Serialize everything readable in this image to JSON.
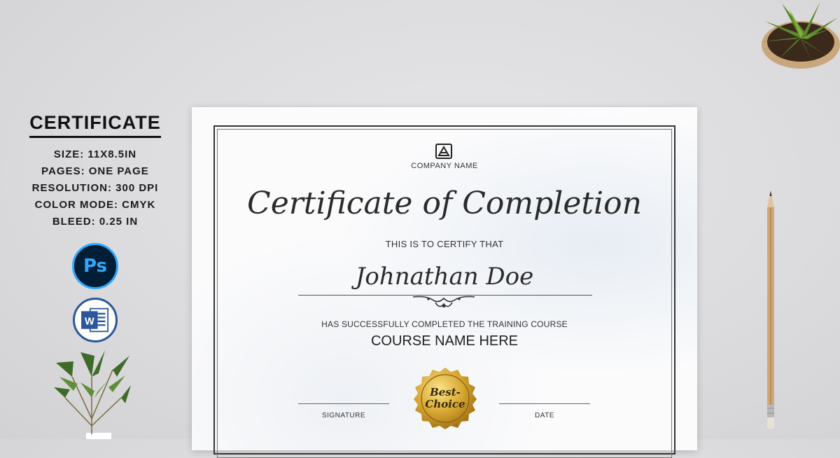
{
  "sidebar": {
    "title": "CERTIFICATE",
    "specs": [
      "SIZE: 11X8.5IN",
      "PAGES: ONE PAGE",
      "RESOLUTION: 300 DPI",
      "COLOR MODE: CMYK",
      "BLEED: 0.25 IN"
    ],
    "apps": [
      {
        "icon": "photoshop-icon",
        "label": "Ps"
      },
      {
        "icon": "word-icon",
        "label": "W"
      }
    ]
  },
  "certificate": {
    "company": "COMPANY NAME",
    "title": "Certificate of Completion",
    "certify_text": "THIS IS TO CERTIFY THAT",
    "recipient": "Johnathan Doe",
    "completed_text": "HAS SUCCESSFULLY COMPLETED THE TRAINING COURSE",
    "course": "COURSE NAME HERE",
    "signature_label": "SIGNATURE",
    "date_label": "DATE",
    "seal_line1": "Best-",
    "seal_line2": "Choice"
  },
  "colors": {
    "seal_gold": "#d6a631",
    "photoshop_blue": "#31a8ff",
    "word_blue": "#2b579a"
  }
}
